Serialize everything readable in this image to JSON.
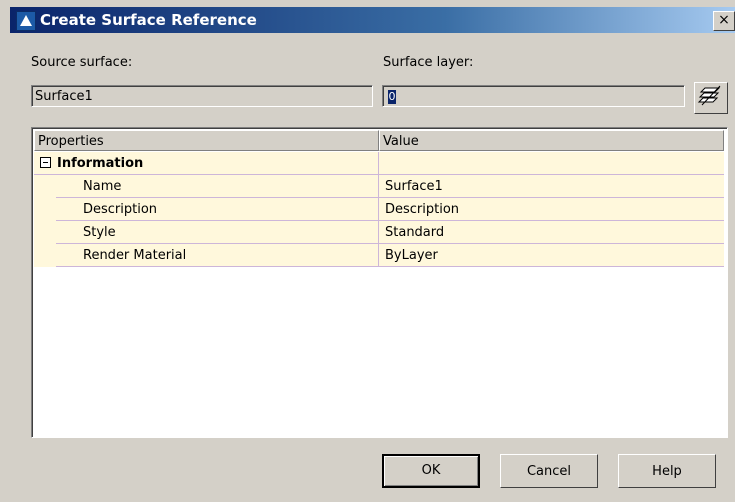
{
  "window": {
    "title": "Create Surface Reference",
    "close_glyph": "×"
  },
  "form": {
    "source_surface_label": "Source surface:",
    "source_surface_value": "Surface1",
    "surface_layer_label": "Surface layer:",
    "surface_layer_value": "0"
  },
  "grid": {
    "columns": [
      "Properties",
      "Value"
    ],
    "group": "Information",
    "rows": [
      {
        "property": "Name",
        "value": "Surface1"
      },
      {
        "property": "Description",
        "value": "Description"
      },
      {
        "property": "Style",
        "value": "Standard"
      },
      {
        "property": "Render Material",
        "value": "ByLayer"
      }
    ]
  },
  "buttons": {
    "ok": "OK",
    "cancel": "Cancel",
    "help": "Help"
  },
  "colors": {
    "row_bg": "#fff8dc",
    "grid_line": "#cdb6d9",
    "title_bar": "#0a246a"
  },
  "icons": {
    "app": "civil3d-app-icon",
    "layer": "layers-icon",
    "collapse": "minus-box-icon"
  }
}
